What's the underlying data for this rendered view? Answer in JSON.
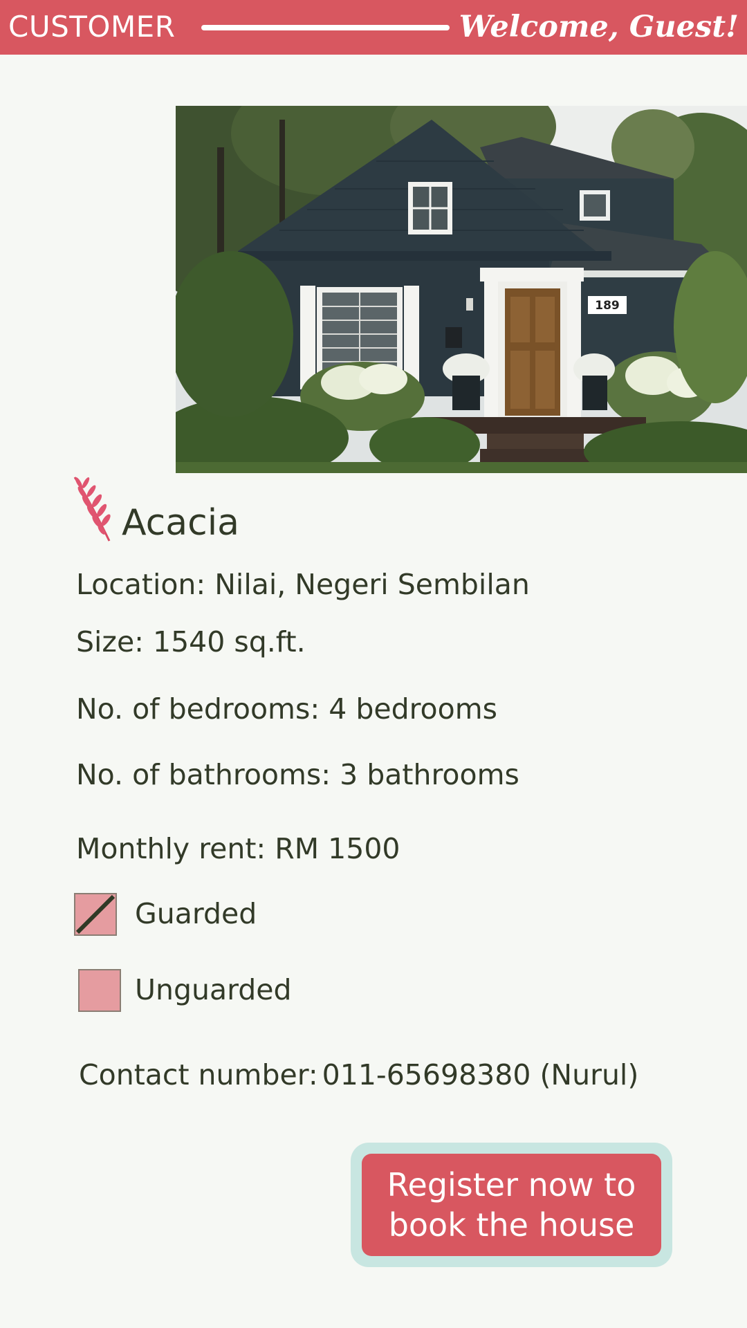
{
  "header": {
    "section_label": "CUSTOMER",
    "welcome_text": "Welcome, Guest!",
    "background_color": "#d85760"
  },
  "property": {
    "image_alt": "Dark blue-grey house with white trim, wooden front door and house number 189",
    "house_number": "189",
    "name_icon": "leaf-icon",
    "name": "Acacia",
    "location": "Location: Nilai, Negeri Sembilan",
    "size": "Size: 1540 sq.ft.",
    "bedrooms": "No. of bedrooms: 4 bedrooms",
    "bathrooms": "No. of bathrooms: 3 bathrooms",
    "rent": "Monthly rent: RM 1500"
  },
  "security_options": [
    {
      "label": "Guarded",
      "checked": true
    },
    {
      "label": "Unguarded",
      "checked": false
    }
  ],
  "contact": {
    "label": "Contact number:",
    "value": "011-65698380 (Nurul)"
  },
  "register_button": {
    "label": "Register now to book the house",
    "color": "#d85760",
    "outline_color": "#c8e6e1"
  }
}
